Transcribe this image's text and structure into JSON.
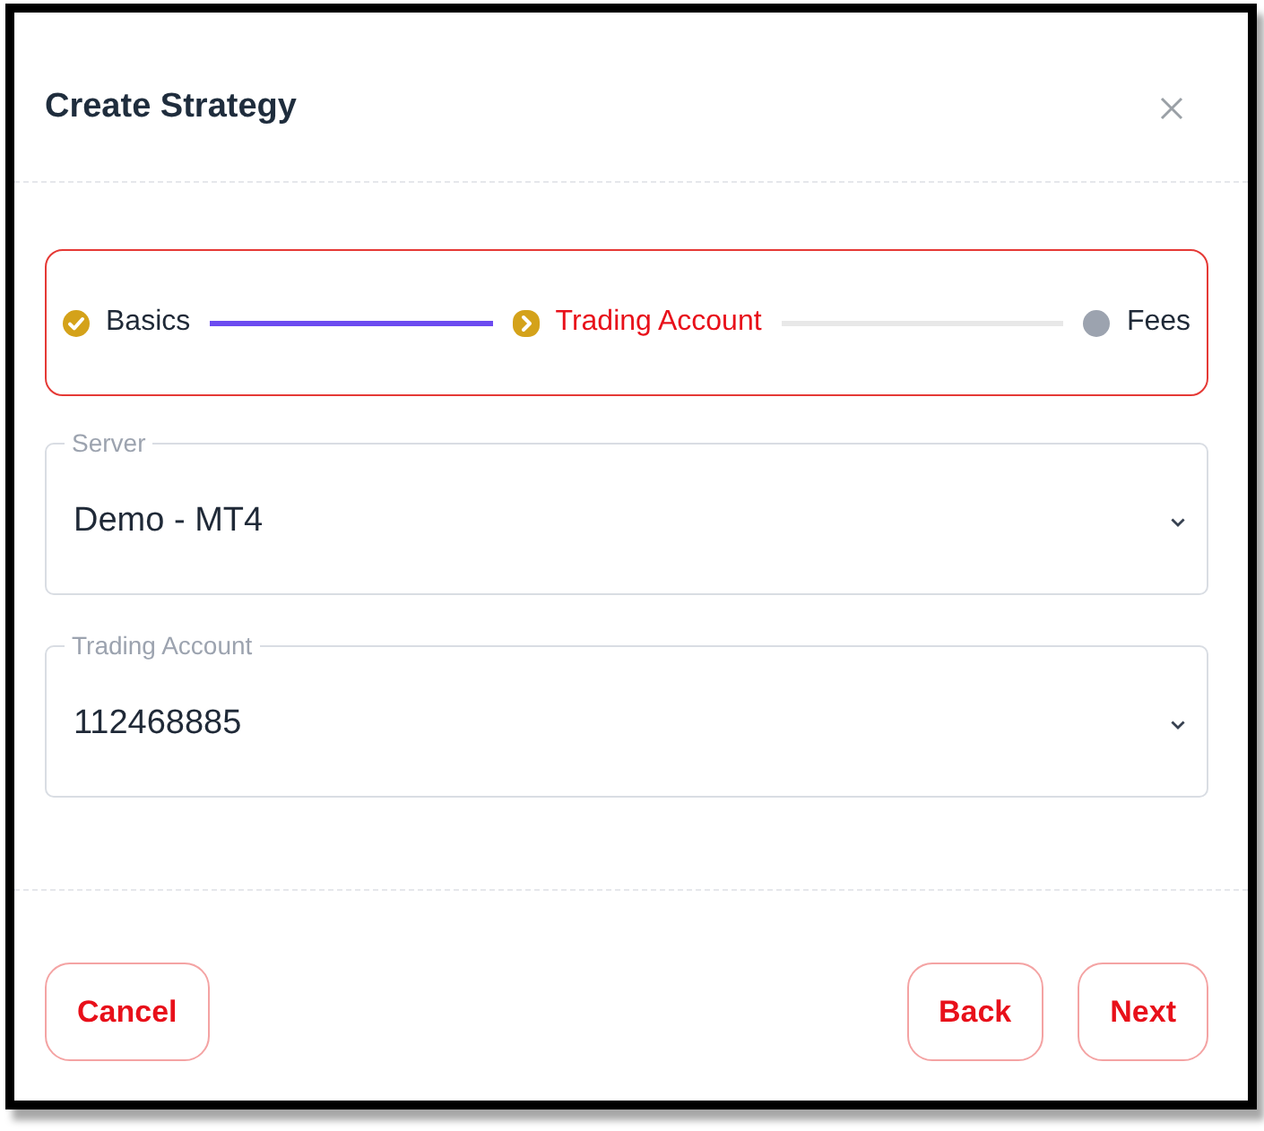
{
  "dialog": {
    "title": "Create Strategy"
  },
  "stepper": {
    "steps": [
      {
        "label": "Basics",
        "completed": true,
        "selected": false
      },
      {
        "label": "Trading Account",
        "completed": false,
        "selected": true
      },
      {
        "label": "Fees",
        "completed": false,
        "selected": false
      }
    ]
  },
  "fields": [
    {
      "label": "Server",
      "value": "Demo - MT4"
    },
    {
      "label": "Trading Account",
      "value": "112468885"
    }
  ],
  "footer": {
    "left_buttons": [
      "Cancel"
    ],
    "right_buttons": [
      "Back",
      "Next"
    ]
  }
}
